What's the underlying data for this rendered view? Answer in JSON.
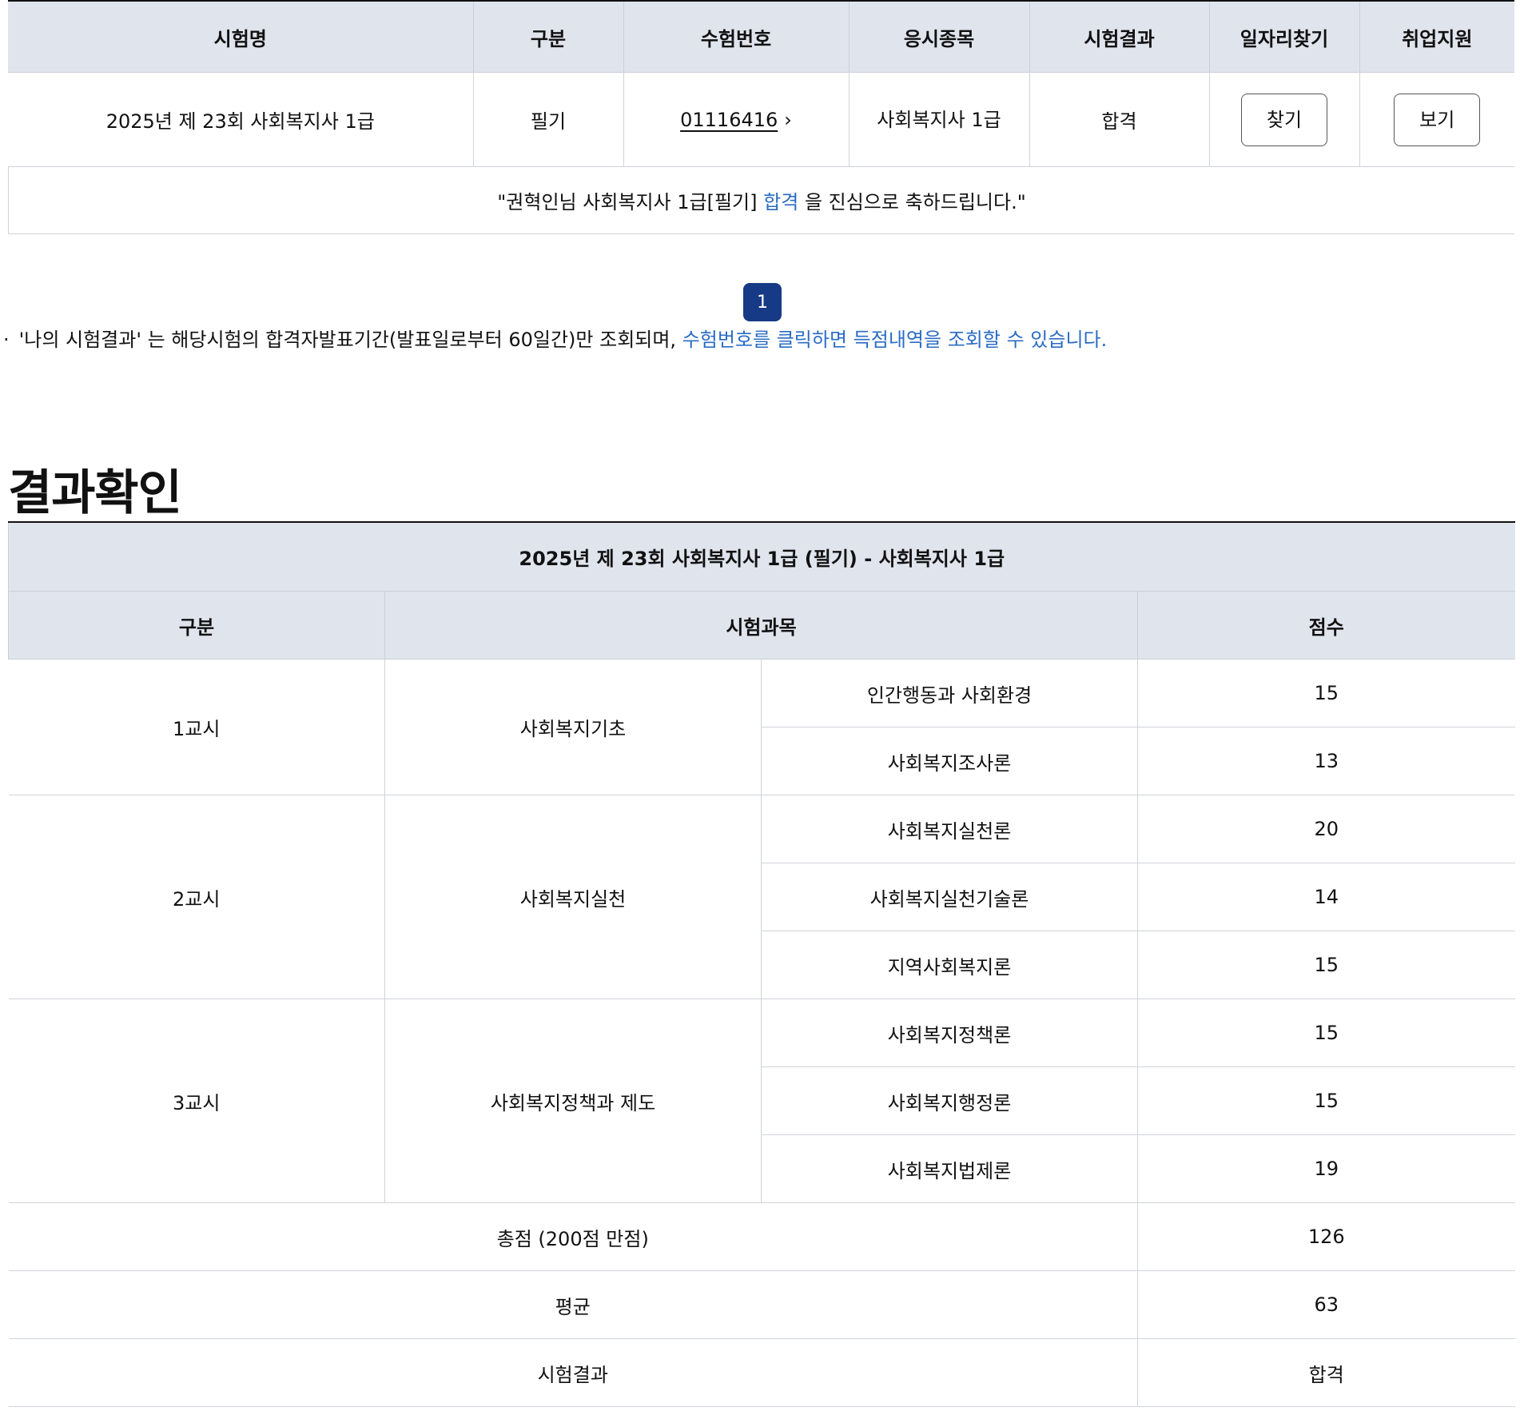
{
  "results_table": {
    "headers": [
      "시험명",
      "구분",
      "수험번호",
      "응시종목",
      "시험결과",
      "일자리찾기",
      "취업지원"
    ],
    "row": {
      "exam_name": "2025년 제 23회 사회복지사 1급",
      "type": "필기",
      "exam_number": "01116416",
      "category": "사회복지사 1급",
      "result": "합격",
      "job_search_button": "찾기",
      "employment_support_button": "보기"
    }
  },
  "congrats": {
    "prefix": "\"권혁인님 사회복지사 1급[필기] ",
    "highlight": "합격",
    "suffix": " 을 진심으로 축하드립니다.\""
  },
  "pagination": {
    "current_page": "1"
  },
  "notice": {
    "bullet": "·",
    "text": "'나의 시험결과' 는 해당시험의 합격자발표기간(발표일로부터 60일간)만 조회되며, ",
    "link_text": "수험번호를 클릭하면 득점내역을 조회할 수 있습니다."
  },
  "section_title": "결과확인",
  "score_table": {
    "caption": "2025년 제 23회 사회복지사 1급 (필기) - 사회복지사 1급",
    "headers": [
      "구분",
      "시험과목",
      "점수"
    ],
    "periods": [
      {
        "period": "1교시",
        "area": "사회복지기초",
        "subjects": [
          {
            "name": "인간행동과 사회환경",
            "score": "15"
          },
          {
            "name": "사회복지조사론",
            "score": "13"
          }
        ]
      },
      {
        "period": "2교시",
        "area": "사회복지실천",
        "subjects": [
          {
            "name": "사회복지실천론",
            "score": "20"
          },
          {
            "name": "사회복지실천기술론",
            "score": "14"
          },
          {
            "name": "지역사회복지론",
            "score": "15"
          }
        ]
      },
      {
        "period": "3교시",
        "area": "사회복지정책과 제도",
        "subjects": [
          {
            "name": "사회복지정책론",
            "score": "15"
          },
          {
            "name": "사회복지행정론",
            "score": "15"
          },
          {
            "name": "사회복지법제론",
            "score": "19"
          }
        ]
      }
    ],
    "total": {
      "label": "총점 (200점 만점)",
      "value": "126"
    },
    "average": {
      "label": "평균",
      "value": "63"
    },
    "final_result": {
      "label": "시험결과",
      "value": "합격"
    }
  },
  "colors": {
    "header_bg": "#e0e4ed",
    "accent_blue": "#2a6cc4",
    "pager_bg": "#173a86"
  },
  "icons": {
    "exam_number_chevron": "chevron-right-icon"
  }
}
